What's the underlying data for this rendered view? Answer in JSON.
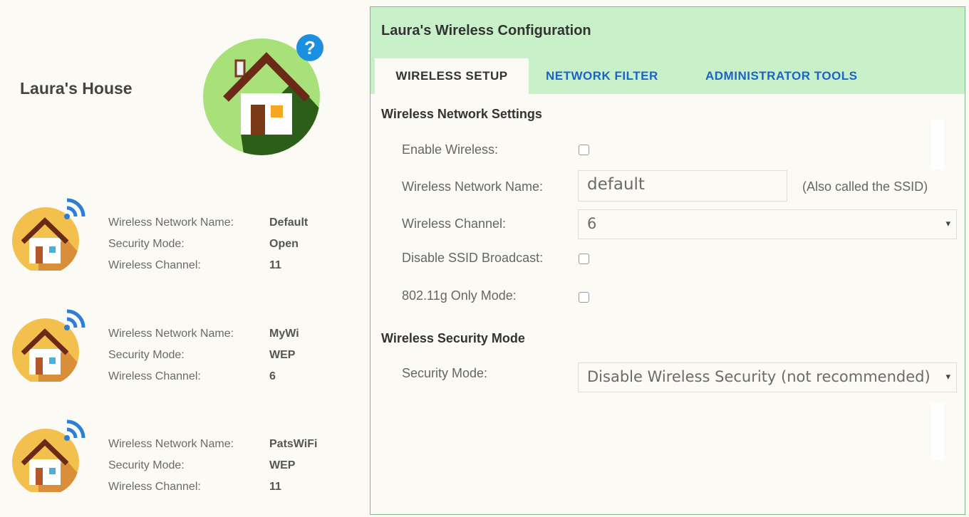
{
  "left": {
    "house_title": "Laura's House",
    "networks": [
      {
        "name_label": "Wireless Network Name:",
        "name_value": "Default",
        "security_label": "Security Mode:",
        "security_value": "Open",
        "channel_label": "Wireless Channel:",
        "channel_value": "11"
      },
      {
        "name_label": "Wireless Network Name:",
        "name_value": "MyWi",
        "security_label": "Security Mode:",
        "security_value": "WEP",
        "channel_label": "Wireless Channel:",
        "channel_value": "6"
      },
      {
        "name_label": "Wireless Network Name:",
        "name_value": "PatsWiFi",
        "security_label": "Security Mode:",
        "security_value": "WEP",
        "channel_label": "Wireless Channel:",
        "channel_value": "11"
      }
    ]
  },
  "panel": {
    "title": "Laura's Wireless Configuration",
    "tabs": [
      "WIRELESS SETUP",
      "NETWORK FILTER",
      "ADMINISTRATOR TOOLS"
    ],
    "active_tab": "WIRELESS SETUP",
    "section_network": "Wireless Network Settings",
    "enable_wireless_label": "Enable Wireless:",
    "enable_wireless_checked": false,
    "network_name_label": "Wireless Network Name:",
    "network_name_value": "default",
    "network_name_hint": "(Also called the SSID)",
    "channel_label": "Wireless Channel:",
    "channel_value": "6",
    "disable_ssid_label": "Disable SSID Broadcast:",
    "disable_ssid_checked": false,
    "g_only_label": "802.11g Only Mode:",
    "g_only_checked": false,
    "section_security": "Wireless Security Mode",
    "security_mode_label": "Security Mode:",
    "security_mode_value": "Disable Wireless Security (not recommended)"
  },
  "colors": {
    "header_green": "#c9f1c9",
    "tab_link_blue": "#1a63c7",
    "help_blue": "#1d8fe0",
    "house_circle_green": "#a8e07a",
    "house_shadow_green": "#2c5e1a",
    "small_house_circle": "#f3c04d",
    "wifi_blue": "#2b7fd4"
  },
  "icons": {
    "help": "question-mark-icon",
    "main_house": "house-icon",
    "network_house": "wifi-house-icon"
  }
}
